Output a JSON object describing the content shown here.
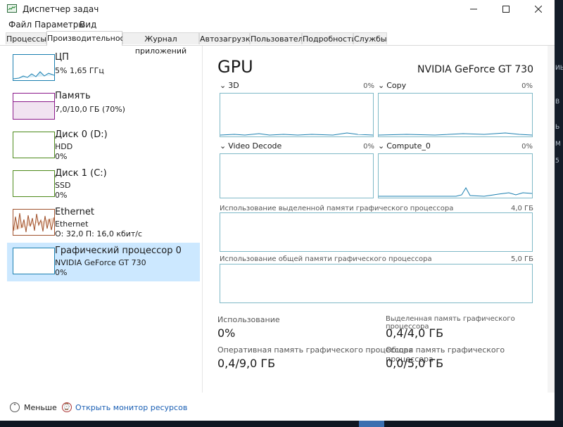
{
  "window": {
    "title": "Диспетчер задач",
    "minimize_icon": "minimize-icon",
    "maximize_icon": "maximize-icon",
    "close_icon": "close-icon"
  },
  "menu": [
    "Файл",
    "Параметры",
    "Вид"
  ],
  "tabs": [
    "Процессы",
    "Производительность",
    "Журнал приложений",
    "Автозагрузка",
    "Пользователи",
    "Подробности",
    "Службы"
  ],
  "active_tab": "Производительность",
  "resources": [
    {
      "title": "ЦП",
      "lines": [
        "5%  1,65 ГГц"
      ]
    },
    {
      "title": "Память",
      "lines": [
        "7,0/10,0 ГБ (70%)"
      ]
    },
    {
      "title": "Диск 0 (D:)",
      "lines": [
        "HDD",
        "0%"
      ]
    },
    {
      "title": "Диск 1 (C:)",
      "lines": [
        "SSD",
        "0%"
      ]
    },
    {
      "title": "Ethernet",
      "lines": [
        "Ethernet",
        "О: 32,0  П: 16,0 кбит/с"
      ]
    },
    {
      "title": "Графический процессор 0",
      "lines": [
        "NVIDIA GeForce GT 730",
        "0%"
      ]
    }
  ],
  "gpu": {
    "title": "GPU",
    "model": "NVIDIA GeForce GT 730",
    "engines": [
      {
        "name": "3D",
        "value": "0%"
      },
      {
        "name": "Copy",
        "value": "0%"
      },
      {
        "name": "Video Decode",
        "value": "0%"
      },
      {
        "name": "Compute_0",
        "value": "0%"
      }
    ],
    "dedicated_mem": {
      "label": "Использование выделенной памяти графического процессора",
      "max": "4,0 ГБ"
    },
    "shared_mem": {
      "label": "Использование общей памяти графического процессора",
      "max": "5,0 ГБ"
    },
    "stats": [
      {
        "label": "Использование",
        "value": "0%"
      },
      {
        "label": "Выделенная память графического процессора",
        "value": "0,4/4,0 ГБ"
      },
      {
        "label": "Оперативная память графического процессора",
        "value": "0,4/9,0 ГБ"
      },
      {
        "label": "Общая память графического процессора",
        "value": "0,0/5,0 ГБ"
      }
    ]
  },
  "footer": {
    "less": "Меньше",
    "monitor": "Открыть монитор ресурсов"
  },
  "desktop_edge": [
    "ИЬ",
    "В",
    "Ь",
    "М",
    "5"
  ],
  "colors": {
    "cpu": "#1a7fb0",
    "memory": "#8b1a8b",
    "disk": "#4d8a1a",
    "ethernet": "#a0522d",
    "gpu": "#1a7fb0",
    "selected": "#cce8ff"
  }
}
